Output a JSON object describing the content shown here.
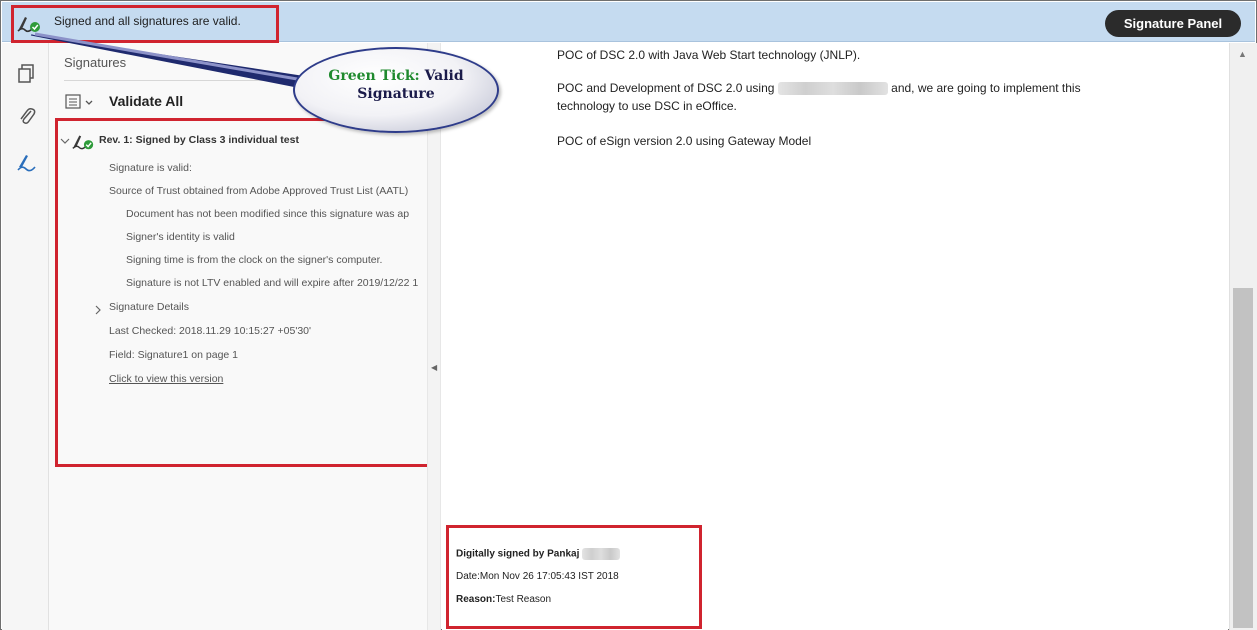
{
  "message_bar": {
    "text": "Signed and all signatures are valid.",
    "signature_panel_button": "Signature Panel"
  },
  "left_icons": [
    "pages-icon",
    "attachment-icon",
    "signature-icon"
  ],
  "side_panel": {
    "title": "Signatures",
    "validate_all": "Validate All",
    "tree": {
      "rev_header": "Rev. 1: Signed by Class 3 individual test",
      "items": [
        "Signature is valid:",
        "Source of Trust obtained from Adobe Approved Trust List (AATL)",
        "Document has not been modified since this signature was ap",
        "Signer's identity is valid",
        "Signing time is from the clock on the signer's computer.",
        "Signature is not LTV enabled and will expire after 2019/12/22 1",
        "Signature Details",
        "Last Checked: 2018.11.29 10:15:27 +05'30'",
        "Field: Signature1 on page 1",
        "Click to view this version"
      ]
    }
  },
  "callout": {
    "highlight": "Green Tick:",
    "rest": "Valid",
    "line2": "Signature"
  },
  "document": {
    "line1": "POC of DSC 2.0 with Java Web Start technology (JNLP).",
    "line2_before": "POC and Development of DSC 2.0 using",
    "line2_after": "and, we are going to implement this",
    "line2b": "technology to use DSC in eOffice.",
    "line3": "POC of eSign version 2.0 using Gateway Model"
  },
  "signature_block": {
    "signed_by": "Digitally signed by Pankaj",
    "date": "Date:Mon Nov 26 17:05:43 IST 2018",
    "reason_label": "Reason:",
    "reason_value": "Test Reason"
  },
  "colors": {
    "message_bar": "#c5dbf0",
    "highlight_red": "#d0242f",
    "valid_green": "#1f8a2e",
    "button_dark": "#2b2b2b"
  }
}
